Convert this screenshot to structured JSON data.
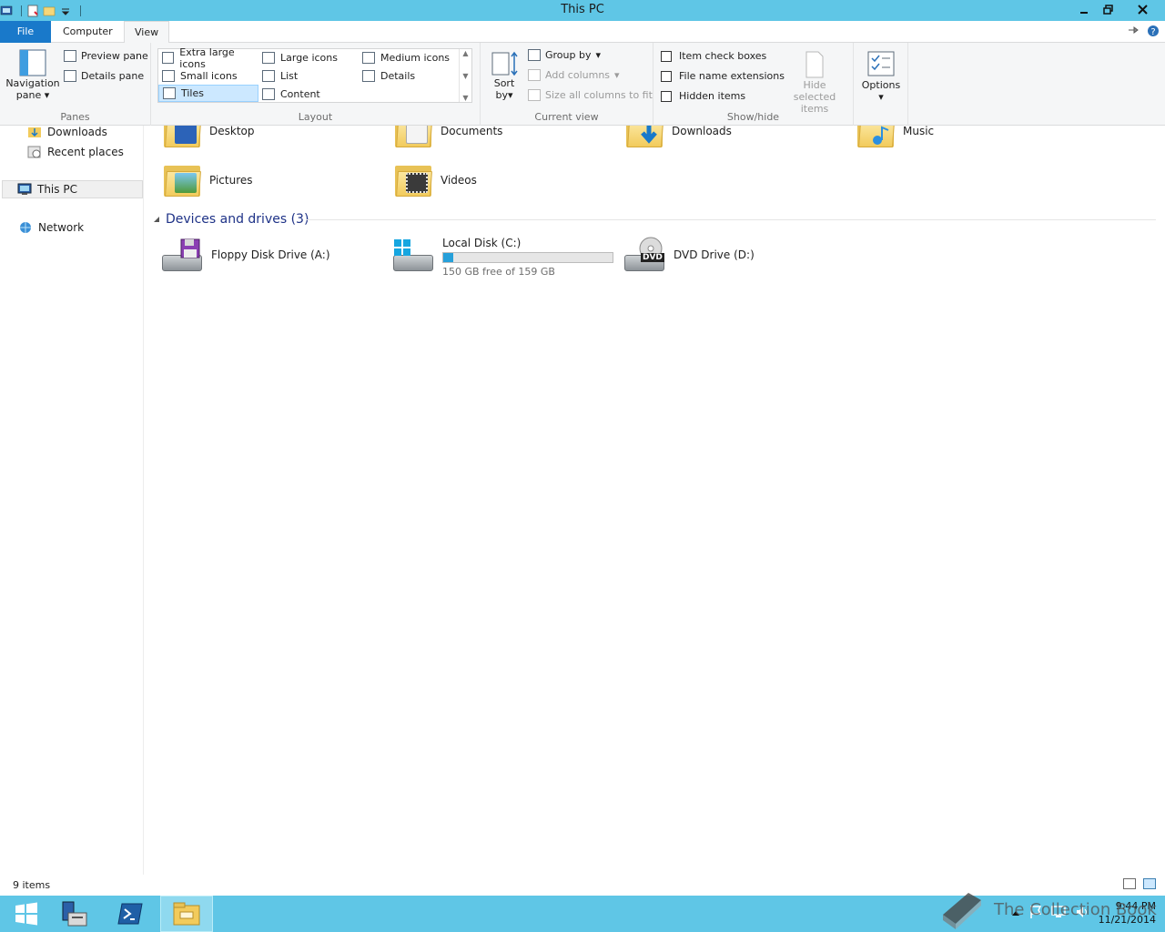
{
  "window": {
    "title": "This PC"
  },
  "ribbon": {
    "tabs": [
      {
        "label": "File"
      },
      {
        "label": "Computer"
      },
      {
        "label": "View"
      }
    ],
    "panes": {
      "label": "Panes",
      "navigation_pane": "Navigation",
      "navigation_pane_2": "pane",
      "preview_pane": "Preview pane",
      "details_pane": "Details pane"
    },
    "layout": {
      "label": "Layout",
      "items": [
        "Extra large icons",
        "Large icons",
        "Medium icons",
        "Small icons",
        "List",
        "Details",
        "Tiles",
        "Content"
      ],
      "selected": "Tiles"
    },
    "current_view": {
      "label": "Current view",
      "sort_by": "Sort",
      "sort_by_2": "by",
      "group_by": "Group by",
      "add_columns": "Add columns",
      "size_columns": "Size all columns to fit"
    },
    "show_hide": {
      "label": "Show/hide",
      "item_check_boxes": "Item check boxes",
      "file_name_extensions": "File name extensions",
      "hidden_items": "Hidden items",
      "hide_selected": "Hide selected",
      "hide_selected_2": "items"
    },
    "options": {
      "label": "Options"
    }
  },
  "nav": {
    "items": [
      {
        "label": "Downloads"
      },
      {
        "label": "Recent places"
      },
      {
        "label": "This PC"
      },
      {
        "label": "Network"
      }
    ]
  },
  "folders": [
    {
      "name": "Desktop"
    },
    {
      "name": "Documents"
    },
    {
      "name": "Downloads"
    },
    {
      "name": "Music"
    },
    {
      "name": "Pictures"
    },
    {
      "name": "Videos"
    }
  ],
  "devices": {
    "header": "Devices and drives (3)",
    "items": [
      {
        "name": "Floppy Disk Drive (A:)"
      },
      {
        "name": "Local Disk (C:)",
        "free": "150 GB free of 159 GB",
        "used_fraction": 0.057
      },
      {
        "name": "DVD Drive (D:)",
        "badge": "DVD"
      }
    ]
  },
  "status": {
    "items": "9 items"
  },
  "taskbar": {
    "clock_time": "9:44 PM",
    "clock_date": "11/21/2014"
  },
  "watermark": "The Collection Book",
  "colors": {
    "titlebar": "#5fc6e6",
    "file_tab": "#1979ca",
    "selection": "#cce8ff",
    "drive_bar": "#26a0da",
    "section_header": "#1e3287"
  }
}
